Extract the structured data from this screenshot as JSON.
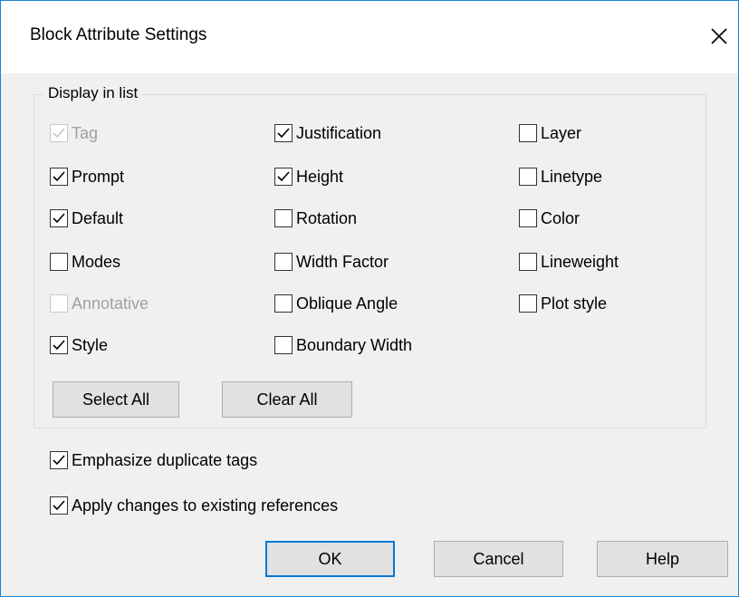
{
  "dialog": {
    "title": "Block Attribute Settings"
  },
  "group": {
    "legend": "Display in list",
    "items": [
      {
        "label": "Tag",
        "checked": true,
        "enabled": false
      },
      {
        "label": "Prompt",
        "checked": true,
        "enabled": true
      },
      {
        "label": "Default",
        "checked": true,
        "enabled": true
      },
      {
        "label": "Modes",
        "checked": false,
        "enabled": true
      },
      {
        "label": "Annotative",
        "checked": false,
        "enabled": false
      },
      {
        "label": "Style",
        "checked": true,
        "enabled": true
      },
      {
        "label": "Justification",
        "checked": true,
        "enabled": true
      },
      {
        "label": "Height",
        "checked": true,
        "enabled": true
      },
      {
        "label": "Rotation",
        "checked": false,
        "enabled": true
      },
      {
        "label": "Width Factor",
        "checked": false,
        "enabled": true
      },
      {
        "label": "Oblique Angle",
        "checked": false,
        "enabled": true
      },
      {
        "label": "Boundary Width",
        "checked": false,
        "enabled": true
      },
      {
        "label": "Layer",
        "checked": false,
        "enabled": true
      },
      {
        "label": "Linetype",
        "checked": false,
        "enabled": true
      },
      {
        "label": "Color",
        "checked": false,
        "enabled": true
      },
      {
        "label": "Lineweight",
        "checked": false,
        "enabled": true
      },
      {
        "label": "Plot style",
        "checked": false,
        "enabled": true
      }
    ],
    "select_all_label": "Select All",
    "clear_all_label": "Clear All"
  },
  "options": {
    "emphasize_duplicates": {
      "label": "Emphasize duplicate tags",
      "checked": true
    },
    "apply_changes": {
      "label": "Apply changes to existing references",
      "checked": true
    }
  },
  "buttons": {
    "ok": "OK",
    "cancel": "Cancel",
    "help": "Help"
  },
  "colors": {
    "accent": "#0078d7",
    "window_border": "#1883d7",
    "disabled_text": "#a0a0a0"
  }
}
